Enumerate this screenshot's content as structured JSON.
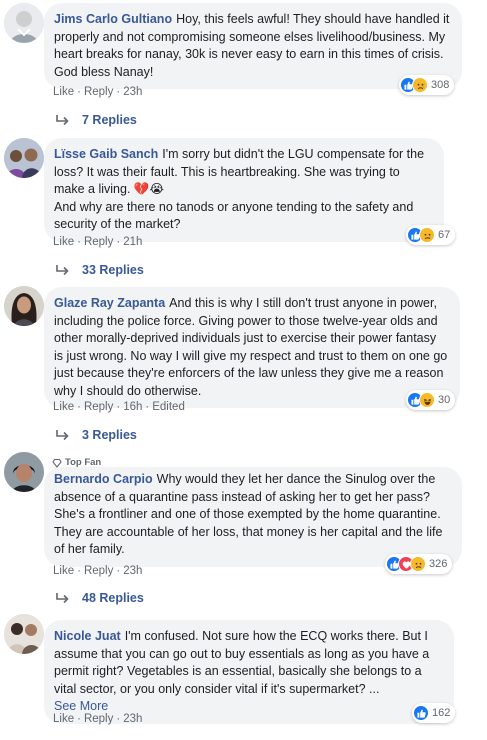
{
  "colors": {
    "link_blue": "#385898",
    "bubble_gray": "#f2f3f5",
    "meta_gray": "#606770",
    "like_blue": "#1877f2",
    "love_red": "#f33e58",
    "emoji_yellow": "#f7b928"
  },
  "comments": [
    {
      "author": "Jims Carlo Gultiano",
      "text": "Hoy, this feels awful! They should have handled it properly and not compromising someone elses livelihood/business. My heart breaks for nanay, 30k is never easy to earn in this times of crisis. God bless Nanay!",
      "actions": {
        "like": "Like",
        "reply": "Reply",
        "time": "23h"
      },
      "reactions": {
        "icons": [
          "like",
          "sad"
        ],
        "count": "308"
      },
      "replies": "7 Replies"
    },
    {
      "author": "Lïsse Gaib Sanch",
      "text": "I'm sorry but didn't the LGU compensate for the loss? It was their fault. This is heartbreaking. She was trying to make a living. 💔😭",
      "text2": "And why are there no tanods or anyone tending to the safety and security of the market?",
      "actions": {
        "like": "Like",
        "reply": "Reply",
        "time": "21h"
      },
      "reactions": {
        "icons": [
          "like",
          "sad"
        ],
        "count": "67"
      },
      "replies": "33 Replies"
    },
    {
      "author": "Glaze Ray Zapanta",
      "text": "And this is why I still don't trust anyone in power, including the police force. Giving power to those twelve-year olds and other morally-deprived individuals just to exercise their power fantasy is just wrong. No way I will give my respect and trust to them on one go just because they're enforcers of the law unless they give me a reason why I should do otherwise.",
      "actions": {
        "like": "Like",
        "reply": "Reply",
        "time": "16h",
        "edited": "Edited"
      },
      "reactions": {
        "icons": [
          "like",
          "haha"
        ],
        "count": "30"
      },
      "replies": "3 Replies"
    },
    {
      "badge": "Top Fan",
      "author": "Bernardo Carpio",
      "text": "Why would they let her dance the Sinulog over the absence of a quarantine pass instead of asking her to get her pass? She's a frontliner and one of those exempted by the home quarantine. They are accountable of her loss, that money is her capital and the life of her family.",
      "actions": {
        "like": "Like",
        "reply": "Reply",
        "time": "23h"
      },
      "reactions": {
        "icons": [
          "like",
          "love",
          "sad"
        ],
        "count": "326"
      },
      "replies": "48 Replies"
    },
    {
      "author": "Nicole Juat",
      "text": "I'm confused. Not sure how the ECQ works there. But I assume that you can go out to buy essentials as long as you have a permit right? Vegetables is an essential, basically she belongs to a vital sector, or you only consider vital if it's supermarket? ...",
      "see_more": "See More",
      "actions": {
        "like": "Like",
        "reply": "Reply",
        "time": "23h"
      },
      "reactions": {
        "icons": [
          "like"
        ],
        "count": "162"
      }
    }
  ]
}
